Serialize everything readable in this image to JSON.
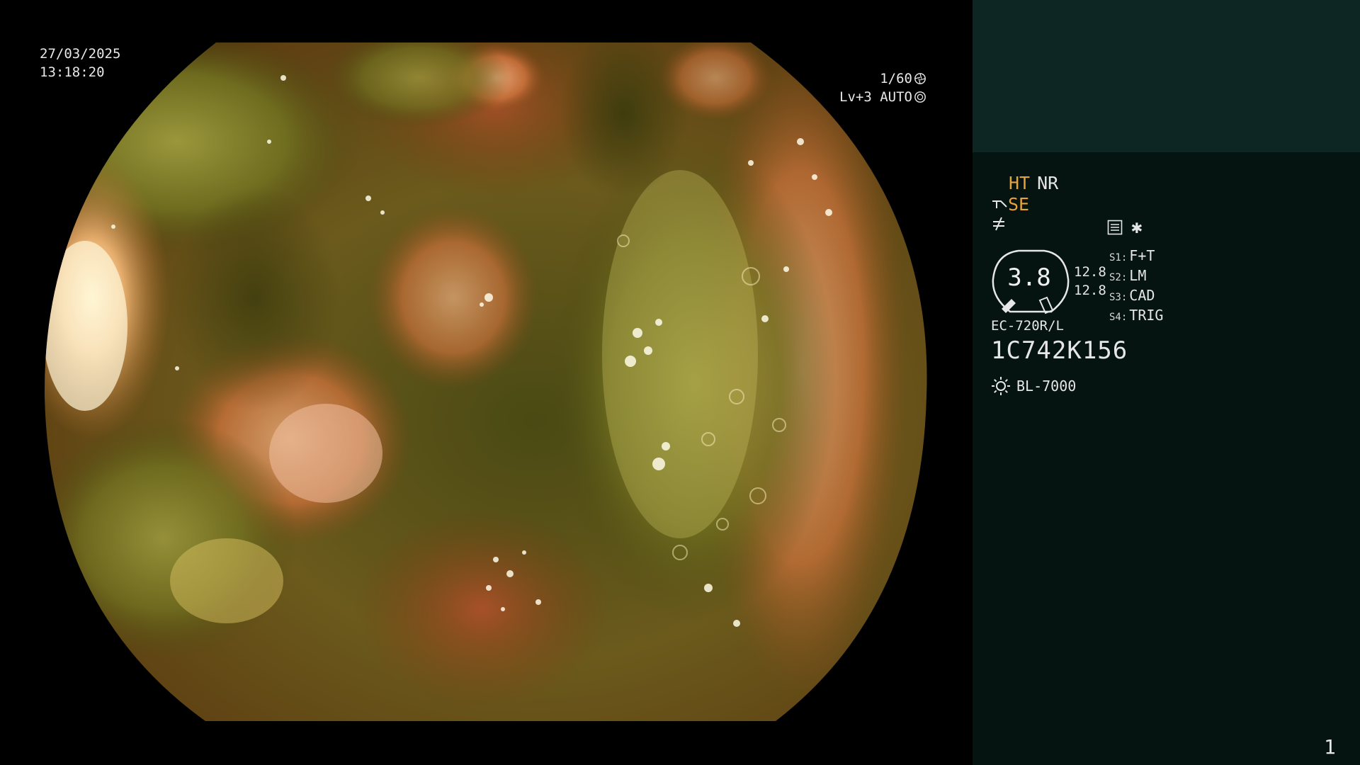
{
  "osd": {
    "date": "27/03/2025",
    "time": "13:18:20",
    "shutter": "1/60",
    "exposure": "Lv+3 AUTO"
  },
  "panel": {
    "mode_ht": "HT",
    "mode_nr": "NR",
    "se_label": "SE",
    "gauge_value": "3.8",
    "fps_top": "12.8",
    "fps_bottom": "12.8",
    "switches": [
      {
        "key": "S1:",
        "value": "F+T"
      },
      {
        "key": "S2:",
        "value": "LM"
      },
      {
        "key": "S3:",
        "value": "CAD"
      },
      {
        "key": "S4:",
        "value": "TRIG"
      }
    ],
    "scope_model": "EC-720R/L",
    "scope_serial": "1C742K156",
    "light_source": "BL-7000",
    "page_number": "1"
  },
  "colors": {
    "panel_bg": "#051411",
    "panel_header_bg": "#0d2623",
    "accent_orange": "#e8a23a",
    "text": "#e6e6e6"
  },
  "icons": {
    "shutter": "aperture-icon",
    "auto": "iris-icon",
    "se": "scope-tip-icon",
    "neq": "not-equal-icon",
    "settings": "menu-list-icon",
    "asterisk": "asterisk-icon",
    "light": "sun-icon"
  }
}
